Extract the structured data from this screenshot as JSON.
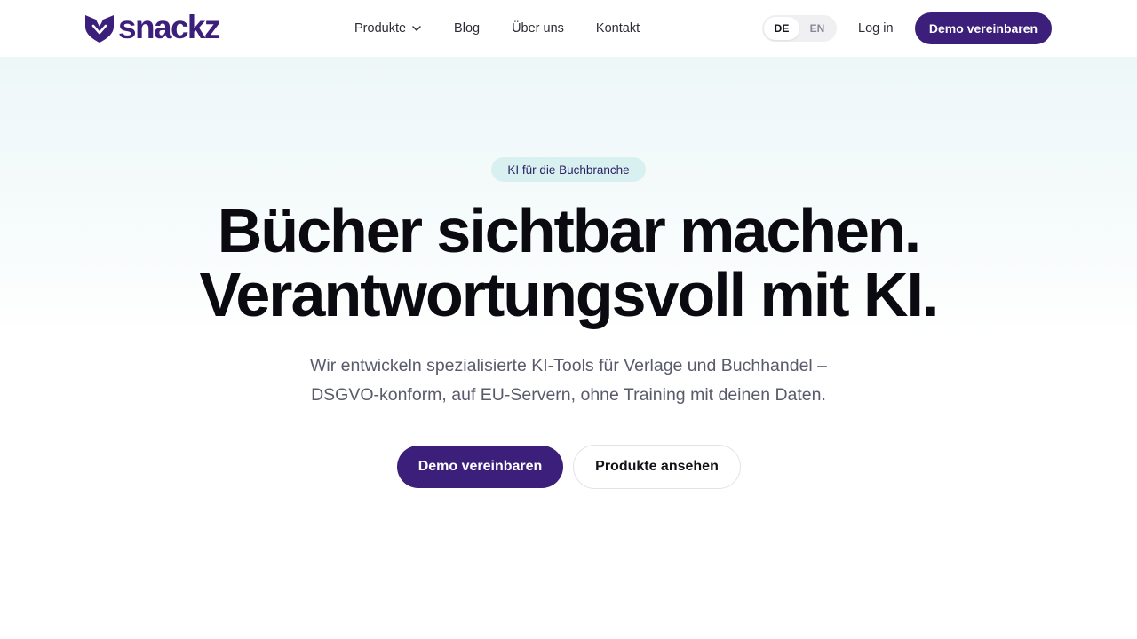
{
  "header": {
    "logo_text": "snackz",
    "nav": [
      {
        "label": "Produkte",
        "has_dropdown": true
      },
      {
        "label": "Blog"
      },
      {
        "label": "Über uns"
      },
      {
        "label": "Kontakt"
      }
    ],
    "languages": [
      {
        "code": "DE",
        "active": true
      },
      {
        "code": "EN",
        "active": false
      }
    ],
    "login_label": "Log in",
    "cta_label": "Demo vereinbaren"
  },
  "hero": {
    "badge": "KI für die Buchbranche",
    "headline_lines": [
      "Bücher sichtbar machen.",
      "Verantwortungsvoll mit KI."
    ],
    "subline_lines": [
      "Wir entwickeln spezialisierte KI-Tools für Verlage und Buchhandel –",
      "DSGVO-konform, auf EU-Servern, ohne Training mit deinen Daten."
    ],
    "primary_cta": "Demo vereinbaren",
    "secondary_cta": "Produkte ansehen"
  },
  "colors": {
    "brand": "#3b1f7a",
    "badge_bg": "#d8f1f0",
    "hero_tint": "#eef7f8",
    "body_text": "#595b6b"
  },
  "icons": {
    "logo": "heart-shield-logo-icon",
    "dropdown": "chevron-down-icon"
  }
}
